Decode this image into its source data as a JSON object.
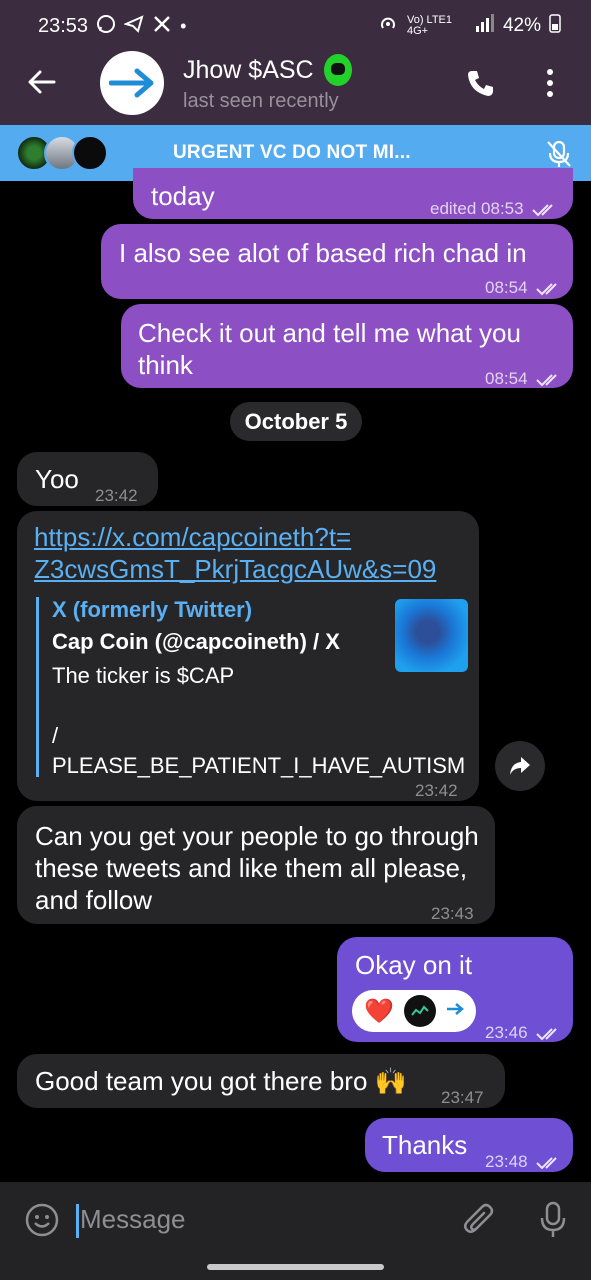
{
  "status_bar": {
    "time": "23:53",
    "left_icons": [
      "whatsapp-icon",
      "telegram-icon",
      "x-icon",
      "dot"
    ],
    "network": "Vo) LTE1 4G+",
    "battery": "42%"
  },
  "header": {
    "contact_name": "Jhow $ASC",
    "status": "last seen recently"
  },
  "voice_chat": {
    "title": "URGENT VC DO NOT MI..."
  },
  "messages": [
    {
      "direction": "out",
      "text": "today",
      "time": "edited 08:53"
    },
    {
      "direction": "out",
      "text": "I also see alot of based rich chad in",
      "time": "08:54"
    },
    {
      "direction": "out",
      "text": "Check it out and tell me what you think",
      "time": "08:54"
    },
    {
      "direction": "date",
      "text": "October 5"
    },
    {
      "direction": "in",
      "text": "Yoo",
      "time": "23:42"
    },
    {
      "direction": "in",
      "link": "https://x.com/capcoineth?t=Z3cwsGmsT_PkrjTacgcAUw&s=09",
      "link_line1": "https://x.com/capcoineth?t=",
      "link_line2": "Z3cwsGmsT_PkrjTacgcAUw&s=09",
      "preview": {
        "site": "X (formerly Twitter)",
        "title": "Cap Coin (@capcoineth) / X",
        "desc1": "The ticker is $CAP",
        "desc2": "/",
        "desc3": "PLEASE_BE_PATIENT_I_HAVE_AUTISM"
      },
      "time": "23:42"
    },
    {
      "direction": "in",
      "text": "Can you get your people to go through these tweets and like them all please, and follow",
      "time": "23:43"
    },
    {
      "direction": "out",
      "text": "Okay on it",
      "reactions": [
        "❤️"
      ],
      "time": "23:46"
    },
    {
      "direction": "in",
      "text": "Good team you got there bro 🙌",
      "time": "23:47"
    },
    {
      "direction": "out",
      "text": "Thanks",
      "time": "23:48"
    }
  ],
  "input": {
    "placeholder": "Message"
  },
  "colors": {
    "header_bg": "#3b2d3f",
    "banner_bg": "#55abf0",
    "outgoing_bubble": "#8c4fc4",
    "incoming_bubble": "#262628",
    "link": "#5ab0f2"
  }
}
